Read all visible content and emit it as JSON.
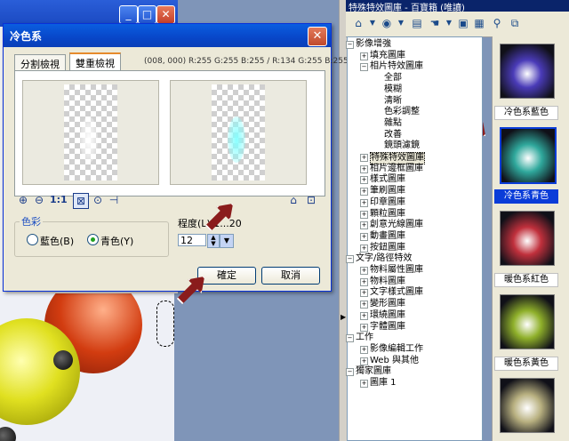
{
  "dialog": {
    "title": "冷色系",
    "close_glyph": "✕",
    "tabs": [
      "分割檢視",
      "雙重檢視"
    ],
    "pixel_info": "(008, 000) R:255 G:255 B:255 / R:134 G:255 B:255",
    "group_label": "色彩",
    "radio_options": [
      "藍色(B)",
      "青色(Y)"
    ],
    "selected_option": "青色(Y)",
    "degree_label": "程度(L) 1...20",
    "degree_value": "12",
    "ok_label": "確定",
    "cancel_label": "取消"
  },
  "main_window": {
    "minimize": "_",
    "maximize": "□",
    "close": "✕"
  },
  "right_panel": {
    "title": "特殊特效圖庫 - 百寶箱 (唯讀)",
    "tree": [
      {
        "label": "影像增強",
        "expander": "−"
      },
      {
        "label": "填充圖庫",
        "expander": "+"
      },
      {
        "label": "相片特效圖庫",
        "expander": "−"
      },
      {
        "label": "全部",
        "expander": ""
      },
      {
        "label": "模糊",
        "expander": ""
      },
      {
        "label": "清晰",
        "expander": ""
      },
      {
        "label": "色彩調整",
        "expander": ""
      },
      {
        "label": "雜點",
        "expander": ""
      },
      {
        "label": "改善",
        "expander": ""
      },
      {
        "label": "鏡頭濾鏡",
        "expander": ""
      },
      {
        "label": "特殊特效圖庫",
        "expander": "+"
      },
      {
        "label": "相片邊框圖庫",
        "expander": "+"
      },
      {
        "label": "樣式圖庫",
        "expander": "+"
      },
      {
        "label": "筆刷圖庫",
        "expander": "+"
      },
      {
        "label": "印章圖庫",
        "expander": "+"
      },
      {
        "label": "顆粒圖庫",
        "expander": "+"
      },
      {
        "label": "創意光線圖庫",
        "expander": "+"
      },
      {
        "label": "動畫圖庫",
        "expander": "+"
      },
      {
        "label": "按鈕圖庫",
        "expander": "+"
      },
      {
        "label": "文字/路徑特效",
        "expander": "−"
      },
      {
        "label": "物料屬性圖庫",
        "expander": "+"
      },
      {
        "label": "物料圖庫",
        "expander": "+"
      },
      {
        "label": "文字樣式圖庫",
        "expander": "+"
      },
      {
        "label": "變形圖庫",
        "expander": "+"
      },
      {
        "label": "環繞圖庫",
        "expander": "+"
      },
      {
        "label": "字體圖庫",
        "expander": "+"
      },
      {
        "label": "工作",
        "expander": "−"
      },
      {
        "label": "影像編輯工作",
        "expander": "+"
      },
      {
        "label": "Web 與其他",
        "expander": "+"
      },
      {
        "label": "獨家圖庫",
        "expander": "−"
      },
      {
        "label": "圖庫 1",
        "expander": "+"
      }
    ],
    "thumbnails": [
      {
        "label": "冷色系藍色",
        "color": "#4a3bb8",
        "selected": false
      },
      {
        "label": "冷色系青色",
        "color": "#2fa89c",
        "selected": true
      },
      {
        "label": "暖色系紅色",
        "color": "#c0303c",
        "selected": false
      },
      {
        "label": "暖色系黃色",
        "color": "#8fb02a",
        "selected": false
      },
      {
        "label": "",
        "color": "#b8b080",
        "selected": false
      }
    ]
  },
  "colors": {
    "title_bar": "#0a5ee0",
    "selection": "#0a3cd8",
    "arrow": "#8a1c1c"
  }
}
